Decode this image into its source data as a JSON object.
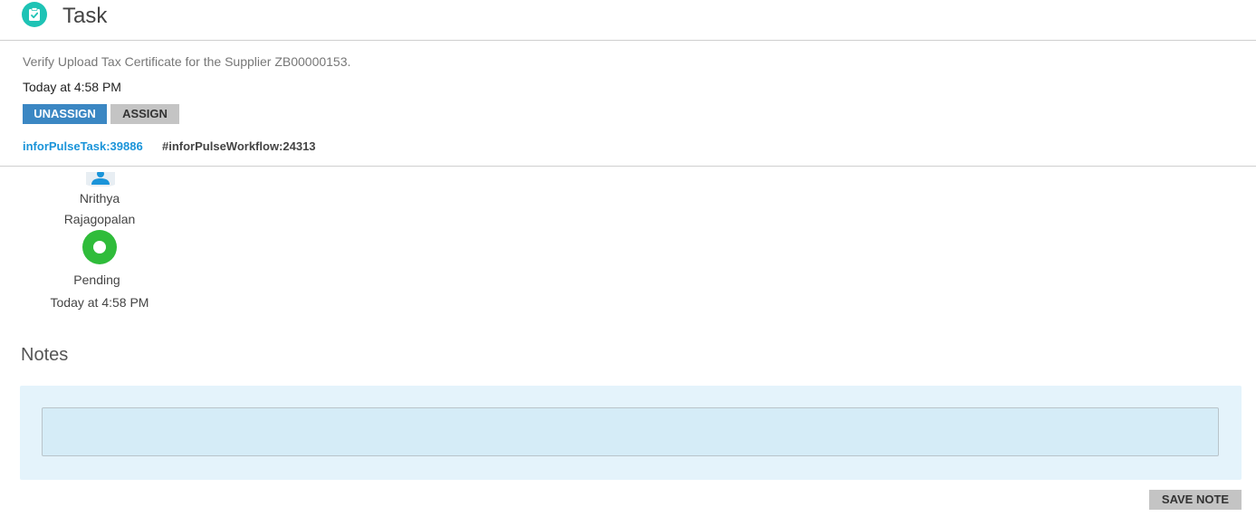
{
  "header": {
    "title": "Task",
    "icon": "clipboard-check-icon",
    "icon_color": "#1ec3b5"
  },
  "task": {
    "description": "Verify Upload Tax Certificate for the Supplier ZB00000153.",
    "timestamp": "Today at 4:58 PM"
  },
  "actions": {
    "unassign_label": "UNASSIGN",
    "assign_label": "ASSIGN",
    "unassign_color": "#3b87c3"
  },
  "tags": {
    "task_link": "inforPulseTask:39886",
    "workflow": "#inforPulseWorkflow:24313"
  },
  "assignee": {
    "icon": "user-icon",
    "name": "Nrithya Rajagopalan"
  },
  "status": {
    "icon": "status-dot-icon",
    "label": "Pending",
    "time": "Today at 4:58 PM",
    "color": "#2fbc3a"
  },
  "notes": {
    "heading": "Notes",
    "input_value": "",
    "save_label": "SAVE NOTE"
  }
}
